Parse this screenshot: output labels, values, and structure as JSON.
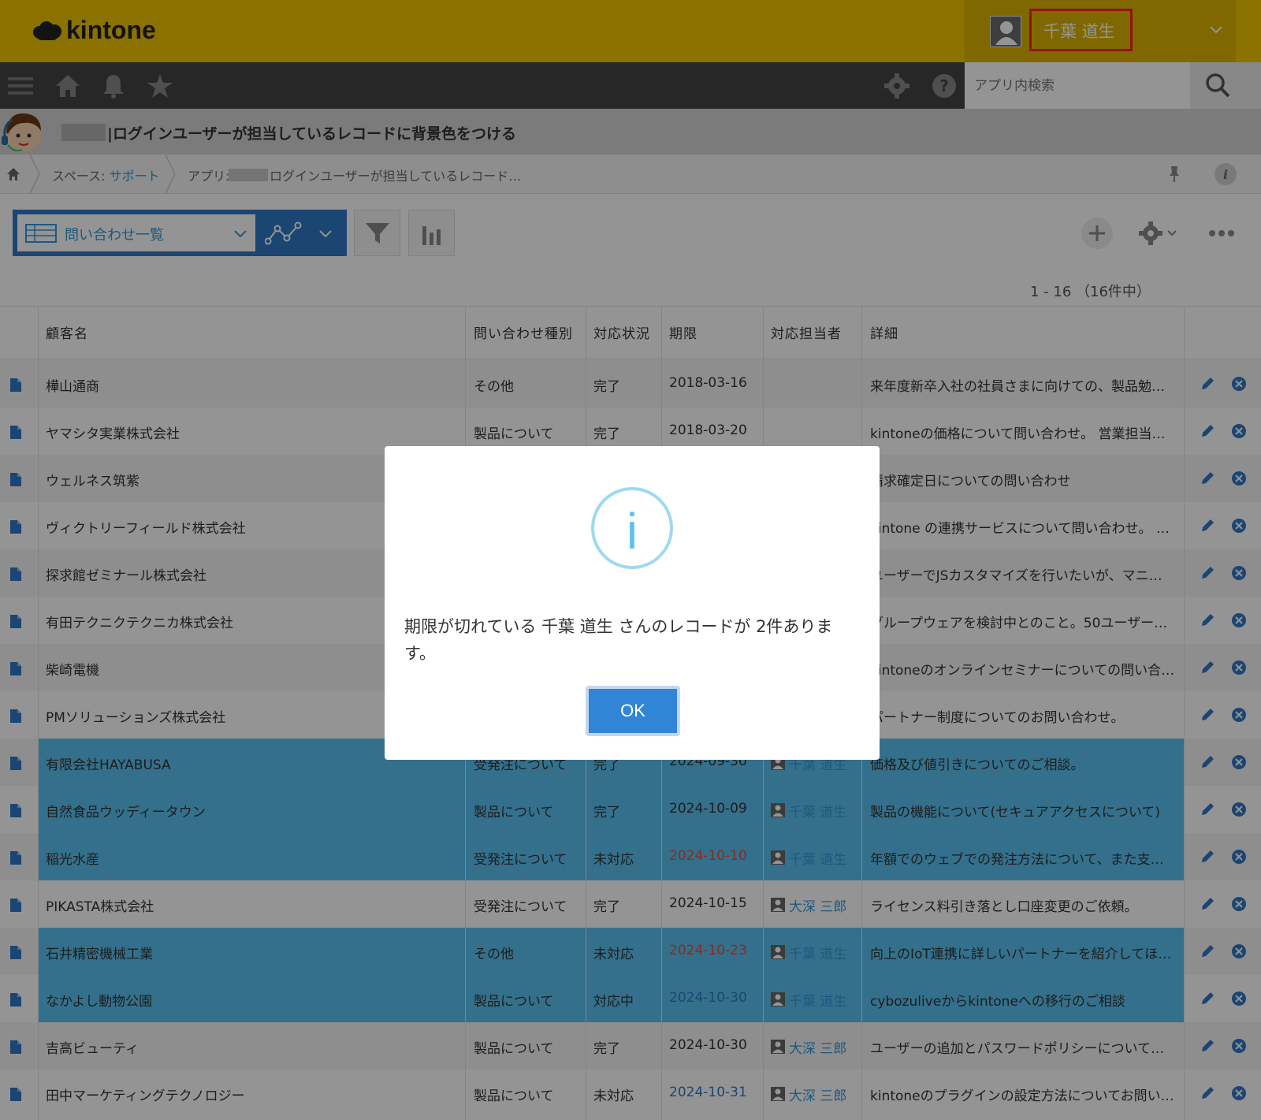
{
  "header": {
    "logo_text": "kintone",
    "user_name": "千葉 道生"
  },
  "nav": {
    "search_placeholder": "アプリ内検索"
  },
  "app": {
    "title": "|ログインユーザーが担当しているレコードに背景色をつける"
  },
  "breadcrumb": {
    "space_label": "スペース: ",
    "space_link": "サポート",
    "app_label": "アプリ:",
    "app_name": "ログインユーザーが担当しているレコード…"
  },
  "toolbar": {
    "view_name": "問い合わせ一覧",
    "record_count": "1 - 16 （16件中）"
  },
  "table": {
    "columns": [
      "顧客名",
      "問い合わせ種別",
      "対応状況",
      "期限",
      "対応担当者",
      "詳細"
    ],
    "rows": [
      {
        "customer": "樺山通商",
        "type": "その他",
        "status": "完了",
        "due": "2018-03-16",
        "due_color": "normal",
        "assignee": "",
        "detail": "来年度新卒入社の社員さまに向けての、製品勉…",
        "highlight": false
      },
      {
        "customer": "ヤマシタ実業株式会社",
        "type": "製品について",
        "status": "完了",
        "due": "2018-03-20",
        "due_color": "normal",
        "assignee": "",
        "detail": "kintoneの価格について問い合わせ。 営業担当…",
        "highlight": false
      },
      {
        "customer": "ウェルネス筑紫",
        "type": "",
        "status": "",
        "due": "",
        "due_color": "normal",
        "assignee": "",
        "detail": "請求確定日についての問い合わせ",
        "highlight": false
      },
      {
        "customer": "ヴィクトリーフィールド株式会社",
        "type": "",
        "status": "",
        "due": "",
        "due_color": "normal",
        "assignee": "",
        "detail": "kintone の連携サービスについて問い合わせ。 …",
        "highlight": false
      },
      {
        "customer": "探求館ゼミナール株式会社",
        "type": "",
        "status": "",
        "due": "",
        "due_color": "normal",
        "assignee": "",
        "detail": "ユーザーでJSカスタマイズを行いたいが、マニ…",
        "highlight": false
      },
      {
        "customer": "有田テクニクテクニカ株式会社",
        "type": "",
        "status": "",
        "due": "",
        "due_color": "normal",
        "assignee": "",
        "detail": "グループウェアを検討中とのこと。50ユーザー…",
        "highlight": false
      },
      {
        "customer": "柴崎電機",
        "type": "",
        "status": "",
        "due": "",
        "due_color": "normal",
        "assignee": "",
        "detail": "kintoneのオンラインセミナーについての問い合…",
        "highlight": false
      },
      {
        "customer": "PMソリューションズ株式会社",
        "type": "",
        "status": "",
        "due": "",
        "due_color": "normal",
        "assignee": "",
        "detail": "パートナー制度についてのお問い合わせ。",
        "highlight": false
      },
      {
        "customer": "有限会社HAYABUSA",
        "type": "受発注について",
        "status": "完了",
        "due": "2024-09-30",
        "due_color": "normal",
        "assignee": "千葉 道生",
        "detail": "価格及び値引きについてのご相談。",
        "highlight": true
      },
      {
        "customer": "自然食品ウッディータウン",
        "type": "製品について",
        "status": "完了",
        "due": "2024-10-09",
        "due_color": "normal",
        "assignee": "千葉 道生",
        "detail": "製品の機能について(セキュアアクセスについて)",
        "highlight": true
      },
      {
        "customer": "稲光水産",
        "type": "受発注について",
        "status": "未対応",
        "due": "2024-10-10",
        "due_color": "red",
        "assignee": "千葉 道生",
        "detail": "年額でのウェブでの発注方法について、また支…",
        "highlight": true
      },
      {
        "customer": "PIKASTA株式会社",
        "type": "受発注について",
        "status": "完了",
        "due": "2024-10-15",
        "due_color": "normal",
        "assignee": "大深 三郎",
        "detail": "ライセンス料引き落とし口座変更のご依頼。",
        "highlight": false
      },
      {
        "customer": "石井精密機械工業",
        "type": "その他",
        "status": "未対応",
        "due": "2024-10-23",
        "due_color": "red",
        "assignee": "千葉 道生",
        "detail": "向上のIoT連携に詳しいパートナーを紹介してほ…",
        "highlight": true
      },
      {
        "customer": "なかよし動物公園",
        "type": "製品について",
        "status": "対応中",
        "due": "2024-10-30",
        "due_color": "blue",
        "assignee": "千葉 道生",
        "detail": "cybozuliveからkintoneへの移行のご相談",
        "highlight": true
      },
      {
        "customer": "吉高ビューティ",
        "type": "製品について",
        "status": "完了",
        "due": "2024-10-30",
        "due_color": "normal",
        "assignee": "大深 三郎",
        "detail": "ユーザーの追加とパスワードポリシーについて…",
        "highlight": false
      },
      {
        "customer": "田中マーケティングテクノロジー",
        "type": "製品について",
        "status": "未対応",
        "due": "2024-10-31",
        "due_color": "blue",
        "assignee": "大深 三郎",
        "detail": "kintoneのプラグインの設定方法についてお問い…",
        "highlight": false
      }
    ]
  },
  "dialog": {
    "message": "期限が切れている 千葉 道生 さんのレコードが 2件あります。",
    "ok_label": "OK",
    "icon_glyph": "i"
  },
  "colors": {
    "header": "#f0c300",
    "nav": "#444444",
    "highlight_row": "#5bc2f0",
    "accent": "#3498db",
    "ok_button": "#3085d6",
    "user_box_border": "#ff2020"
  }
}
